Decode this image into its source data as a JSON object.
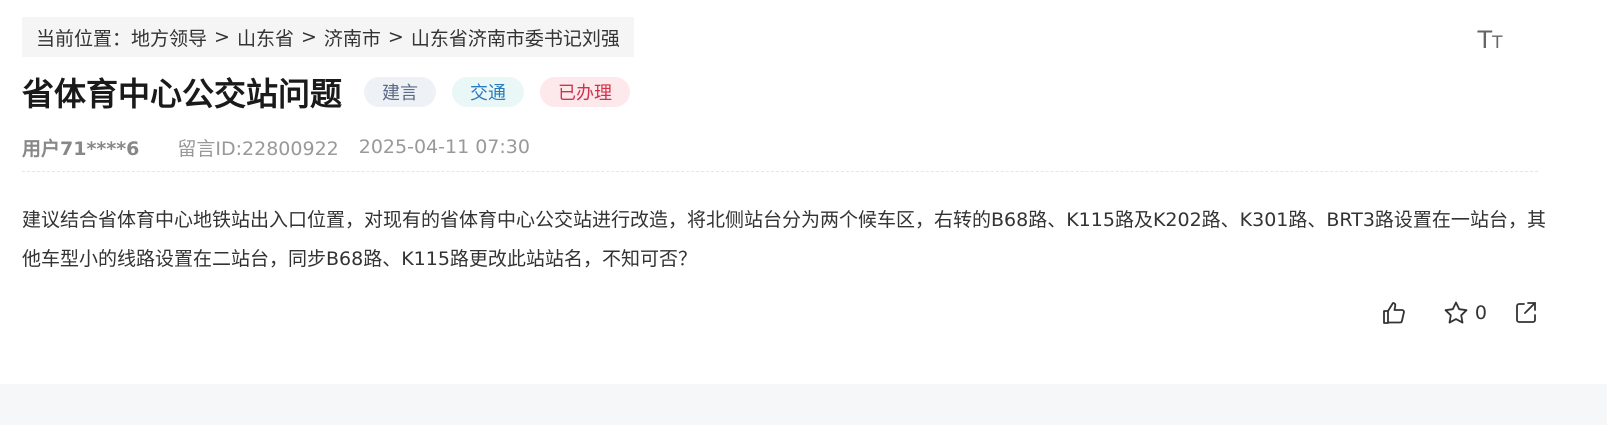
{
  "breadcrumb": {
    "prefix": "当前位置：",
    "items": [
      "地方领导",
      "山东省",
      "济南市",
      "山东省济南市委书记刘强"
    ],
    "separator": ">"
  },
  "font_toggle": {
    "big": "T",
    "small": "T"
  },
  "post": {
    "title": "省体育中心公交站问题",
    "tags": {
      "type": "建言",
      "category": "交通",
      "status": "已办理"
    },
    "user": "用户71****6",
    "message_id": "留言ID:22800922",
    "datetime": "2025-04-11 07:30",
    "content": "建议结合省体育中心地铁站出入口位置，对现有的省体育中心公交站进行改造，将北侧站台分为两个候车区，右转的B68路、K115路及K202路、K301路、BRT3路设置在一站台，其他车型小的线路设置在二站台，同步B68路、K115路更改此站站名，不知可否？"
  },
  "actions": {
    "favorite_count": "0",
    "icons": [
      "thumbs-up-icon",
      "star-icon",
      "share-icon"
    ]
  },
  "colors": {
    "tag_type_bg": "#eef2f7",
    "tag_category_bg": "#e9f8f7",
    "tag_status_bg": "#fde8ec",
    "tag_status_text": "#d0344a",
    "tag_category_text": "#2a7bbd"
  }
}
